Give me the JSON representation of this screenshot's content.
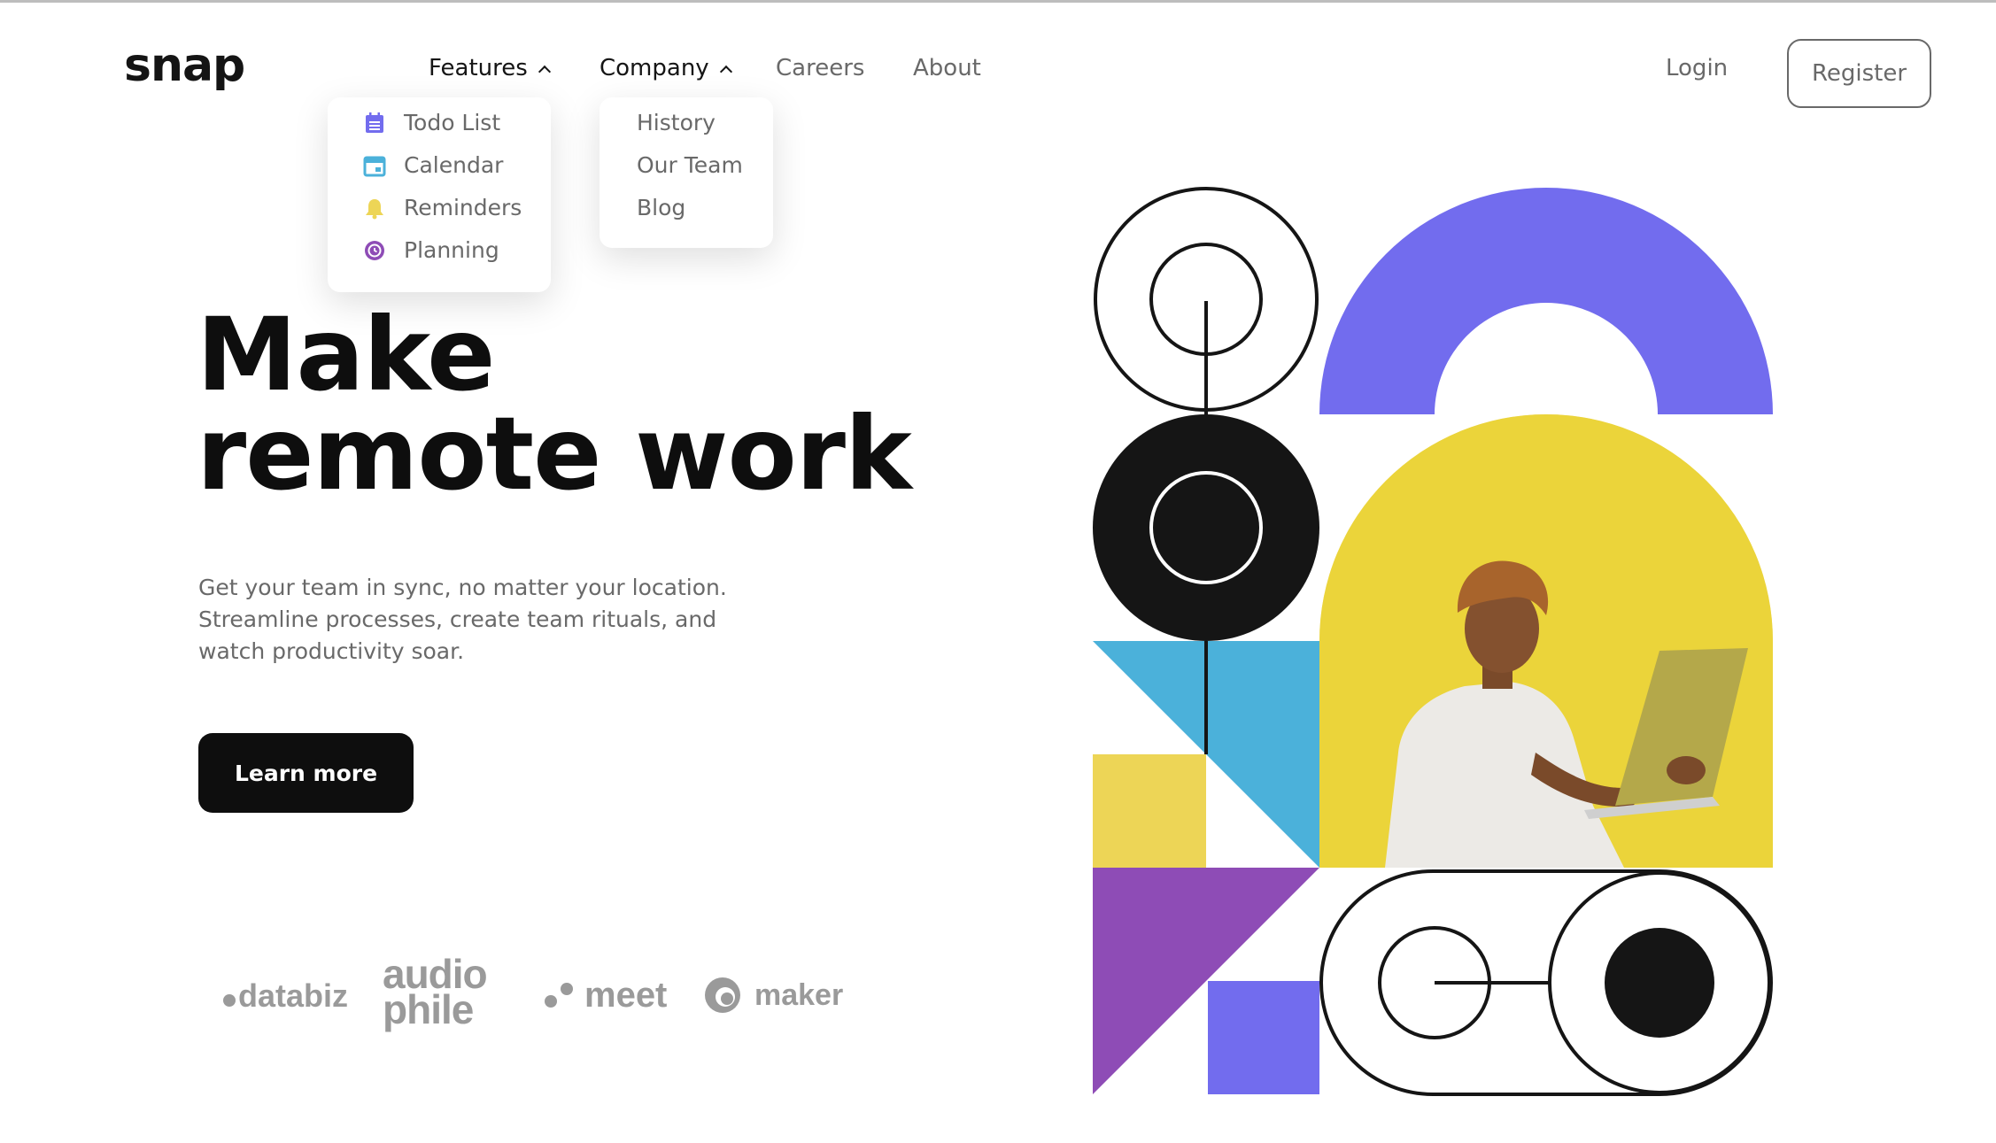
{
  "brand": {
    "logo": "snap"
  },
  "nav": {
    "features": "Features",
    "company": "Company",
    "careers": "Careers",
    "about": "About",
    "login": "Login",
    "register": "Register"
  },
  "features_menu": [
    {
      "label": "Todo List",
      "icon": "todo-list-icon",
      "color": "#726CEE"
    },
    {
      "label": "Calendar",
      "icon": "calendar-icon",
      "color": "#4BB1DA"
    },
    {
      "label": "Reminders",
      "icon": "bell-icon",
      "color": "#EDD556"
    },
    {
      "label": "Planning",
      "icon": "clock-icon",
      "color": "#8E4CB6"
    }
  ],
  "company_menu": [
    {
      "label": "History"
    },
    {
      "label": "Our Team"
    },
    {
      "label": "Blog"
    }
  ],
  "hero": {
    "title_line1": "Make",
    "title_line2": "remote work",
    "text_line1": "Get your team in sync, no matter your location.",
    "text_line2": "Streamline processes, create team rituals, and",
    "text_line3": "watch productivity soar.",
    "cta": "Learn more"
  },
  "clients": {
    "databiz": "databiz",
    "audiophile_1": "audio",
    "audiophile_2": "phile",
    "meet": "meet",
    "maker": "maker"
  },
  "colors": {
    "purple": "#726CEE",
    "yellow": "#EDD556",
    "blue": "#4BB1DA",
    "violet": "#8E4CB6",
    "black": "#151515",
    "gray": "#696969"
  }
}
